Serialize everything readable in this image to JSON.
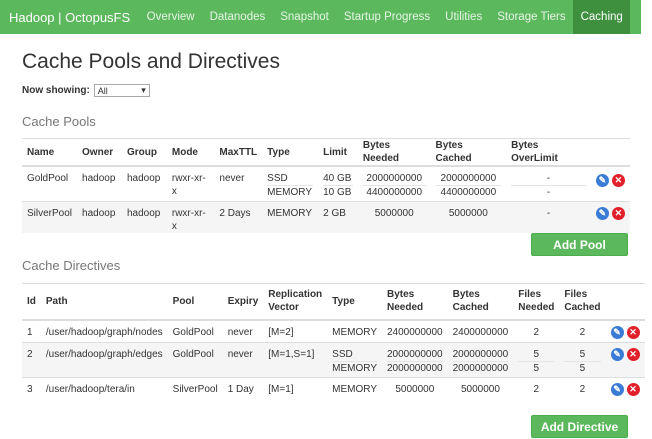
{
  "nav": {
    "brand": "Hadoop | OctopusFS",
    "items": [
      "Overview",
      "Datanodes",
      "Snapshot",
      "Startup Progress",
      "Utilities",
      "Storage Tiers",
      "Caching"
    ],
    "active": "Caching"
  },
  "page": {
    "title": "Cache Pools and Directives",
    "now_showing_label": "Now showing:",
    "now_showing_value": "All"
  },
  "pools": {
    "title": "Cache Pools",
    "headers": [
      "Name",
      "Owner",
      "Group",
      "Mode",
      "MaxTTL",
      "Type",
      "Limit",
      "Bytes Needed",
      "Bytes Cached",
      "Bytes OverLimit"
    ],
    "rows": [
      {
        "name": "GoldPool",
        "owner": "hadoop",
        "group": "hadoop",
        "mode": "rwxr-xr-x",
        "maxttl": "never",
        "types": [
          "SSD",
          "MEMORY"
        ],
        "limits": [
          "40 GB",
          "10 GB"
        ],
        "needed": [
          "2000000000",
          "4400000000"
        ],
        "cached": [
          "2000000000",
          "4400000000"
        ],
        "overlimit": [
          "-",
          "-"
        ]
      },
      {
        "name": "SilverPool",
        "owner": "hadoop",
        "group": "hadoop",
        "mode": "rwxr-xr-x",
        "maxttl": "2 Days",
        "types": [
          "MEMORY"
        ],
        "limits": [
          "2 GB"
        ],
        "needed": [
          "5000000"
        ],
        "cached": [
          "5000000"
        ],
        "overlimit": [
          "-"
        ]
      }
    ],
    "add_button": "Add Pool"
  },
  "directives": {
    "title": "Cache Directives",
    "headers": [
      "Id",
      "Path",
      "Pool",
      "Expiry",
      "Replication Vector",
      "Type",
      "Bytes Needed",
      "Bytes Cached",
      "Files Needed",
      "Files Cached"
    ],
    "rows": [
      {
        "id": "1",
        "path": "/user/hadoop/graph/nodes",
        "pool": "GoldPool",
        "expiry": "never",
        "vector": "[M=2]",
        "types": [
          "MEMORY"
        ],
        "needed": [
          "2400000000"
        ],
        "cached": [
          "2400000000"
        ],
        "fneeded": [
          "2"
        ],
        "fcached": [
          "2"
        ]
      },
      {
        "id": "2",
        "path": "/user/hadoop/graph/edges",
        "pool": "GoldPool",
        "expiry": "never",
        "vector": "[M=1,S=1]",
        "types": [
          "SSD",
          "MEMORY"
        ],
        "needed": [
          "2000000000",
          "2000000000"
        ],
        "cached": [
          "2000000000",
          "2000000000"
        ],
        "fneeded": [
          "5",
          "5"
        ],
        "fcached": [
          "5",
          "5"
        ]
      },
      {
        "id": "3",
        "path": "/user/hadoop/tera/in",
        "pool": "SilverPool",
        "expiry": "1 Day",
        "vector": "[M=1]",
        "types": [
          "MEMORY"
        ],
        "needed": [
          "5000000"
        ],
        "cached": [
          "5000000"
        ],
        "fneeded": [
          "2"
        ],
        "fcached": [
          "2"
        ]
      }
    ],
    "add_button": "Add Directive"
  },
  "icons": {
    "edit": "pencil-icon",
    "delete": "x-icon"
  }
}
